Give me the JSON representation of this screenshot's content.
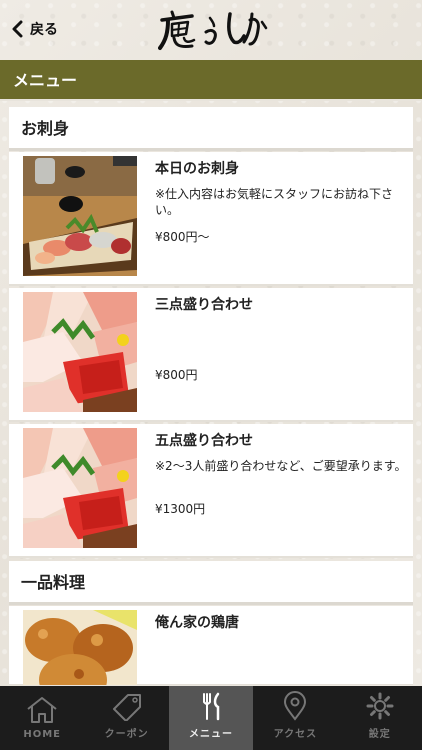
{
  "header": {
    "back_label": "戻る",
    "logo_text": "鹿らしか"
  },
  "page_title": "メニュー",
  "sections": [
    {
      "title": "お刺身",
      "items": [
        {
          "name": "本日のお刺身",
          "desc": "※仕入内容はお気軽にスタッフにお訪ね下さい。",
          "price": "¥800円〜"
        },
        {
          "name": "三点盛り合わせ",
          "desc": "",
          "price": "¥800円"
        },
        {
          "name": "五点盛り合わせ",
          "desc": "※2〜3人前盛り合わせなど、ご要望承ります。",
          "price": "¥1300円"
        }
      ]
    },
    {
      "title": "一品料理",
      "items": [
        {
          "name": "俺ん家の鶏唐",
          "desc": "",
          "price": ""
        }
      ]
    }
  ],
  "tabs": [
    {
      "label": "HOME",
      "icon": "home-icon"
    },
    {
      "label": "クーポン",
      "icon": "coupon-icon"
    },
    {
      "label": "メニュー",
      "icon": "fork-knife-icon",
      "active": true
    },
    {
      "label": "アクセス",
      "icon": "map-pin-icon"
    },
    {
      "label": "設定",
      "icon": "gear-icon"
    }
  ],
  "colors": {
    "title_bar": "#6b6a2a",
    "tab_bar": "#1c1c1c",
    "active_tab": "#555555"
  }
}
